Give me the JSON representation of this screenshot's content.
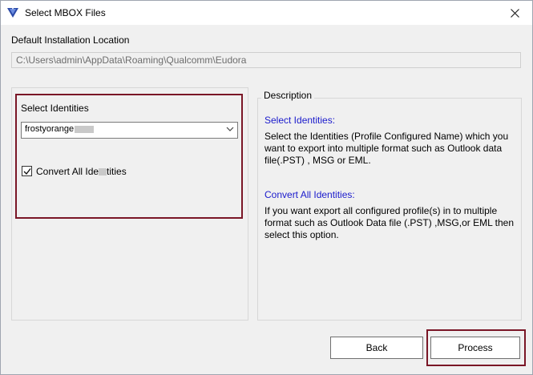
{
  "window": {
    "title": "Select MBOX Files",
    "close_icon": "close-icon",
    "app_icon": "app-shield-icon"
  },
  "install": {
    "label": "Default Installation Location",
    "path": "C:\\Users\\admin\\AppData\\Roaming\\Qualcomm\\Eudora"
  },
  "identities": {
    "label": "Select Identities",
    "selected_value": "frostyorange",
    "convert_checked": true,
    "convert_label_before": "Convert All Ide",
    "convert_label_after": "tities"
  },
  "description": {
    "legend": "Description",
    "select_heading": "Select Identities:",
    "select_body": "Select the Identities (Profile Configured Name) which you want to export into multiple format such as Outlook data file(.PST) , MSG or EML.",
    "convert_heading": "Convert All Identities:",
    "convert_body": "If you want export all configured profile(s) in to multiple format such as Outlook Data file (.PST) ,MSG,or EML then select this option."
  },
  "buttons": {
    "back": "Back",
    "process": "Process"
  },
  "colors": {
    "highlight_border": "#7a1626",
    "heading_blue": "#1a1acc"
  }
}
